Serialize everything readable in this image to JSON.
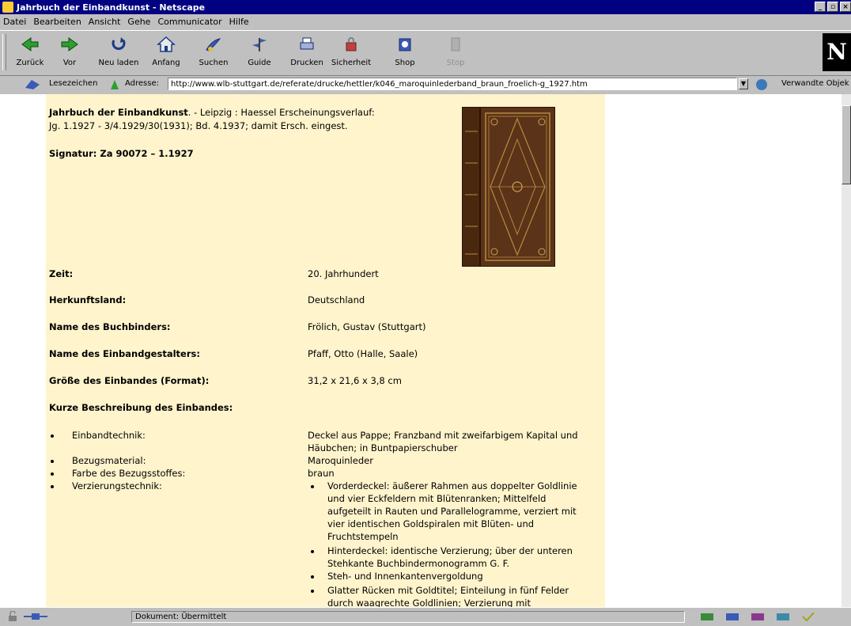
{
  "window": {
    "title": "Jahrbuch der Einbandkunst - Netscape"
  },
  "menu": [
    "Datei",
    "Bearbeiten",
    "Ansicht",
    "Gehe",
    "Communicator",
    "Hilfe"
  ],
  "toolbar": {
    "buttons": [
      {
        "label": "Zurück",
        "icon": "back-arrow-icon"
      },
      {
        "label": "Vor",
        "icon": "forward-arrow-icon"
      },
      {
        "label": "Neu laden",
        "icon": "reload-icon"
      },
      {
        "label": "Anfang",
        "icon": "home-icon"
      },
      {
        "label": "Suchen",
        "icon": "search-icon"
      },
      {
        "label": "Guide",
        "icon": "guide-icon"
      },
      {
        "label": "Drucken",
        "icon": "print-icon"
      },
      {
        "label": "Sicherheit",
        "icon": "lock-icon"
      },
      {
        "label": "Shop",
        "icon": "shop-icon"
      },
      {
        "label": "Stop",
        "icon": "stop-icon"
      }
    ],
    "logo": "N"
  },
  "location": {
    "bookmarks_label": "Lesezeichen",
    "address_label": "Adresse:",
    "url": "http://www.wlb-stuttgart.de/referate/drucke/hettler/k046_maroquinlederband_braun_froelich-g_1927.htm",
    "related_label": "Verwandte Objek"
  },
  "page": {
    "title_bold": "Jahrbuch der Einbandkunst",
    "title_rest": ". - Leipzig : Haessel Erscheinungsverlauf:",
    "title_line2": "Jg. 1.1927 - 3/4.1929/30(1931); Bd. 4.1937; damit Ersch. eingest.",
    "signatur": "Signatur: Za 90072 – 1.1927",
    "fields": [
      {
        "label": "Zeit:",
        "value": "20. Jahrhundert"
      },
      {
        "label": "Herkunftsland:",
        "value": "Deutschland"
      },
      {
        "label": "Name des Buchbinders:",
        "value": "Frölich, Gustav (Stuttgart)"
      },
      {
        "label": "Name des Einbandgestalters:",
        "value": "Pfaff, Otto (Halle, Saale)"
      },
      {
        "label": "Größe des Einbandes (Format):",
        "value": "31,2 x 21,6 x 3,8 cm"
      }
    ],
    "section": "Kurze Beschreibung des Einbandes:",
    "desc": [
      {
        "label": "Einbandtechnik:",
        "lines": [
          "Deckel aus Pappe; Franzband mit zweifarbigem Kapital und",
          "Häubchen; in Buntpapierschuber"
        ]
      },
      {
        "label": "Bezugsmaterial:",
        "lines": [
          "Maroquinleder"
        ]
      },
      {
        "label": "Farbe des Bezugsstoffes:",
        "lines": [
          "braun"
        ]
      },
      {
        "label": "Verzierungstechnik:",
        "lines": []
      }
    ],
    "verzierung": [
      [
        "Vorderdeckel: äußerer Rahmen aus doppelter Goldlinie",
        "und vier Eckfeldern mit Blütenranken; Mittelfeld",
        "aufgeteilt in Rauten und Parallelogramme, verziert mit",
        "vier identischen Goldspiralen mit Blüten- und",
        "Fruchtstempeln"
      ],
      [
        "Hinterdeckel: identische Verzierung; über der unteren",
        "Stehkante Buchbindermonogramm G. F."
      ],
      [
        "Steh- und Innenkantenvergoldung"
      ],
      [
        "Glatter Rücken mit Goldtitel; Einteilung in fünf Felder",
        "durch waagrechte Goldlinien; Verzierung mit"
      ]
    ]
  },
  "status": {
    "text": "Dokument: Übermittelt"
  }
}
